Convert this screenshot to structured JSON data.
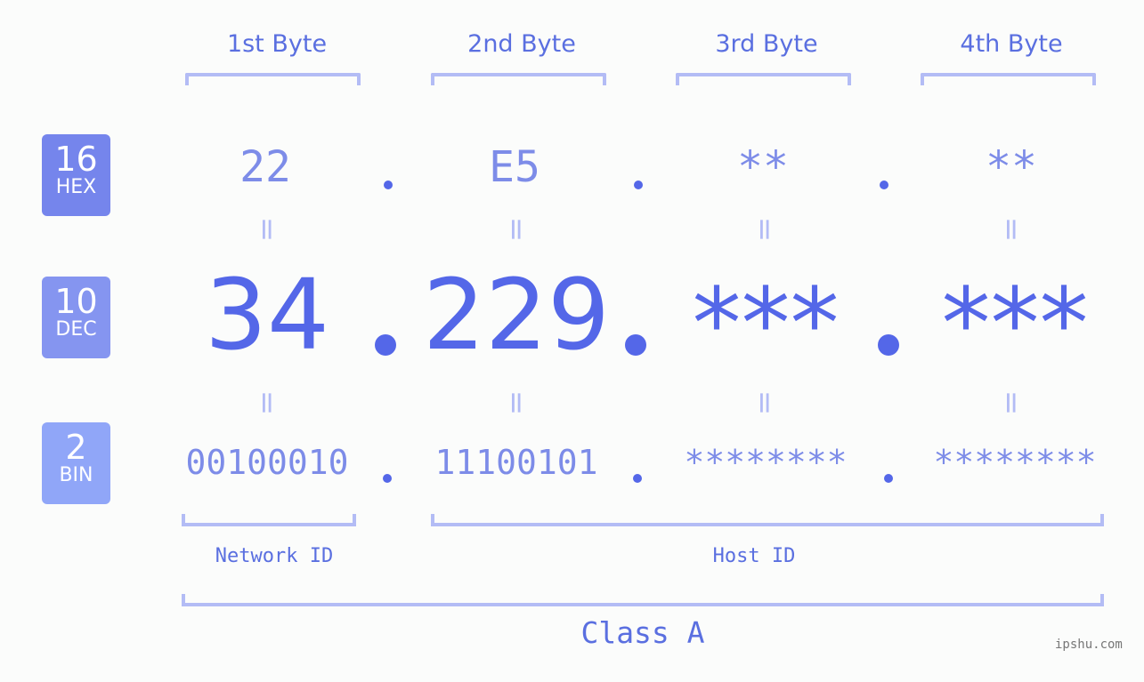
{
  "bytes": [
    {
      "label": "1st Byte",
      "hex": "22",
      "dec": "34",
      "bin": "00100010"
    },
    {
      "label": "2nd Byte",
      "hex": "E5",
      "dec": "229",
      "bin": "11100101"
    },
    {
      "label": "3rd Byte",
      "hex": "**",
      "dec": "***",
      "bin": "********"
    },
    {
      "label": "4th Byte",
      "hex": "**",
      "dec": "***",
      "bin": "********"
    }
  ],
  "badges": {
    "hex": {
      "number": "16",
      "label": "HEX",
      "color": "#7585ec"
    },
    "dec": {
      "number": "10",
      "label": "DEC",
      "color": "#8595f0"
    },
    "bin": {
      "number": "2",
      "label": "BIN",
      "color": "#90a6f8"
    }
  },
  "equals_symbol": "=",
  "network_id_label": "Network ID",
  "host_id_label": "Host ID",
  "class_label": "Class A",
  "watermark": "ipshu.com",
  "colors": {
    "accent": "#5467e8",
    "light_accent": "#7d8ce8",
    "bracket": "#b3bcf5"
  }
}
